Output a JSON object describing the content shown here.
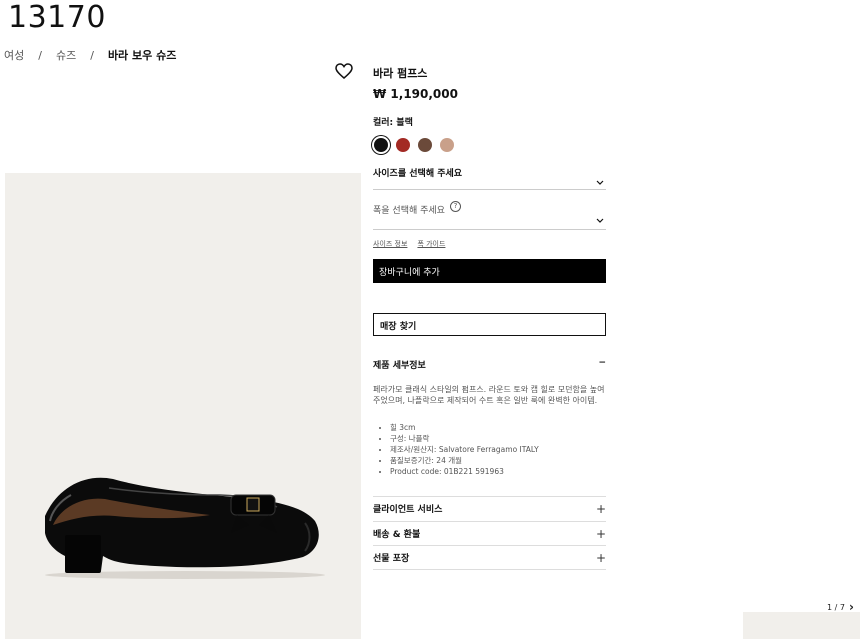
{
  "page_id": "13170",
  "breadcrumb": [
    {
      "label": "여성"
    },
    {
      "label": "슈즈"
    },
    {
      "label": "바라 보우 슈즈"
    }
  ],
  "breadcrumb_sep": "/",
  "product": {
    "name": "바라 펌프스",
    "price": "₩ 1,190,000",
    "color_label": "컬러: 블랙",
    "swatches": [
      {
        "name": "black",
        "color": "#111111",
        "selected": true
      },
      {
        "name": "red",
        "color": "#a32a24"
      },
      {
        "name": "brown",
        "color": "#6b4a3a"
      },
      {
        "name": "nude",
        "color": "#c9a08a"
      }
    ],
    "size_select": "사이즈를 선택해 주세요",
    "width_select": "폭을 선택해 주세요",
    "help_icon": "?",
    "links": {
      "size_info": "사이즈 정보",
      "width_guide": "폭 가이드"
    },
    "add_to_cart": "장바구니에 추가",
    "find_store": "매장 찾기"
  },
  "details": {
    "title": "제품 세부정보",
    "toggle": "−",
    "description": "페라가모 클래식 스타일의 펌프스. 라운드 토와 캡 힐로 모던함을 높여주었으며, 나플락으로 제작되어 수트 혹은 일반 룩에 완벽한 아이템.",
    "specs": [
      "힐 3cm",
      "구성: 나플락",
      "제조사/원산지: Salvatore Ferragamo ITALY",
      "품질보증기간: 24 개월",
      "Product code: 01B221 591963"
    ]
  },
  "accordions": [
    {
      "label": "클라이언트 서비스",
      "icon": "+"
    },
    {
      "label": "배송 & 환불",
      "icon": "+"
    },
    {
      "label": "선물 포장",
      "icon": "+"
    }
  ],
  "gallery": {
    "pager": "1 / 7",
    "next": "›"
  },
  "colors": {
    "accent": "#000000",
    "image_bg": "#f1efeb",
    "border": "#cccccc"
  }
}
